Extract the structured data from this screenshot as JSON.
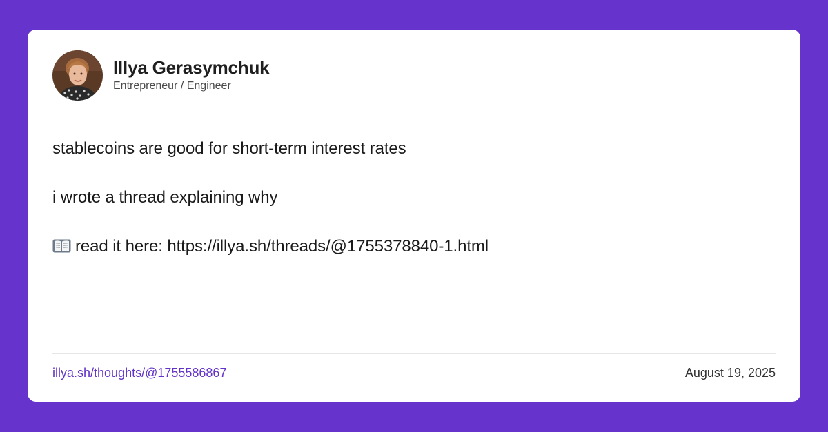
{
  "author": {
    "name": "Illya Gerasymchuk",
    "role": "Entrepreneur / Engineer",
    "avatar_icon": "profile-photo"
  },
  "post": {
    "lines": [
      "stablecoins are good for short-term interest rates",
      "i wrote a thread explaining why",
      "read it here: https://illya.sh/threads/@1755378840-1.html"
    ],
    "link_line_icon": "open-book-icon"
  },
  "footer": {
    "link": "illya.sh/thoughts/@1755586867",
    "date": "August 19, 2025"
  },
  "colors": {
    "background": "#6633cc",
    "card": "#ffffff",
    "link": "#6233c8",
    "text": "#1a1a1a"
  }
}
